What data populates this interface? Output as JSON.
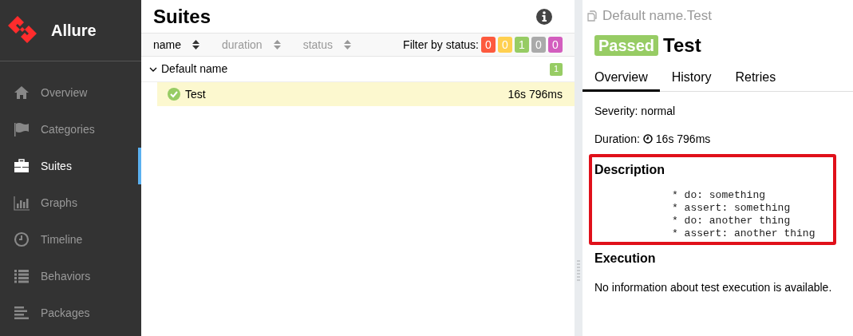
{
  "sidebar": {
    "brand": "Allure",
    "items": [
      {
        "label": "Overview",
        "selected": false
      },
      {
        "label": "Categories",
        "selected": false
      },
      {
        "label": "Suites",
        "selected": true
      },
      {
        "label": "Graphs",
        "selected": false
      },
      {
        "label": "Timeline",
        "selected": false
      },
      {
        "label": "Behaviors",
        "selected": false
      },
      {
        "label": "Packages",
        "selected": false
      }
    ]
  },
  "suites": {
    "title": "Suites",
    "columns": [
      {
        "label": "name",
        "selected": true
      },
      {
        "label": "duration",
        "selected": false
      },
      {
        "label": "status",
        "selected": false
      }
    ],
    "filter_label": "Filter by status:",
    "filters": [
      {
        "count": "0",
        "color": "#fd5a3e"
      },
      {
        "count": "0",
        "color": "#ffd050"
      },
      {
        "count": "1",
        "color": "#97cc64"
      },
      {
        "count": "0",
        "color": "#aaaaaa"
      },
      {
        "count": "0",
        "color": "#d35ebe"
      }
    ],
    "groups": [
      {
        "name": "Default name",
        "expanded": true,
        "count": "1",
        "color": "#97cc64",
        "children": [
          {
            "name": "Test",
            "duration": "16s 796ms",
            "selected": true
          }
        ]
      }
    ]
  },
  "details": {
    "path": "Default name.Test",
    "status": "Passed",
    "title": "Test",
    "tabs": [
      {
        "label": "Overview",
        "selected": true
      },
      {
        "label": "History",
        "selected": false
      },
      {
        "label": "Retries",
        "selected": false
      }
    ],
    "severity": "Severity: normal",
    "duration_label": "Duration:",
    "duration": "16s 796ms",
    "description_heading": "Description",
    "description_lines": [
      "* do: something",
      "* assert: something",
      "* do: another thing",
      "* assert: another thing"
    ],
    "execution_heading": "Execution",
    "execution_text": "No information about test execution is available."
  }
}
